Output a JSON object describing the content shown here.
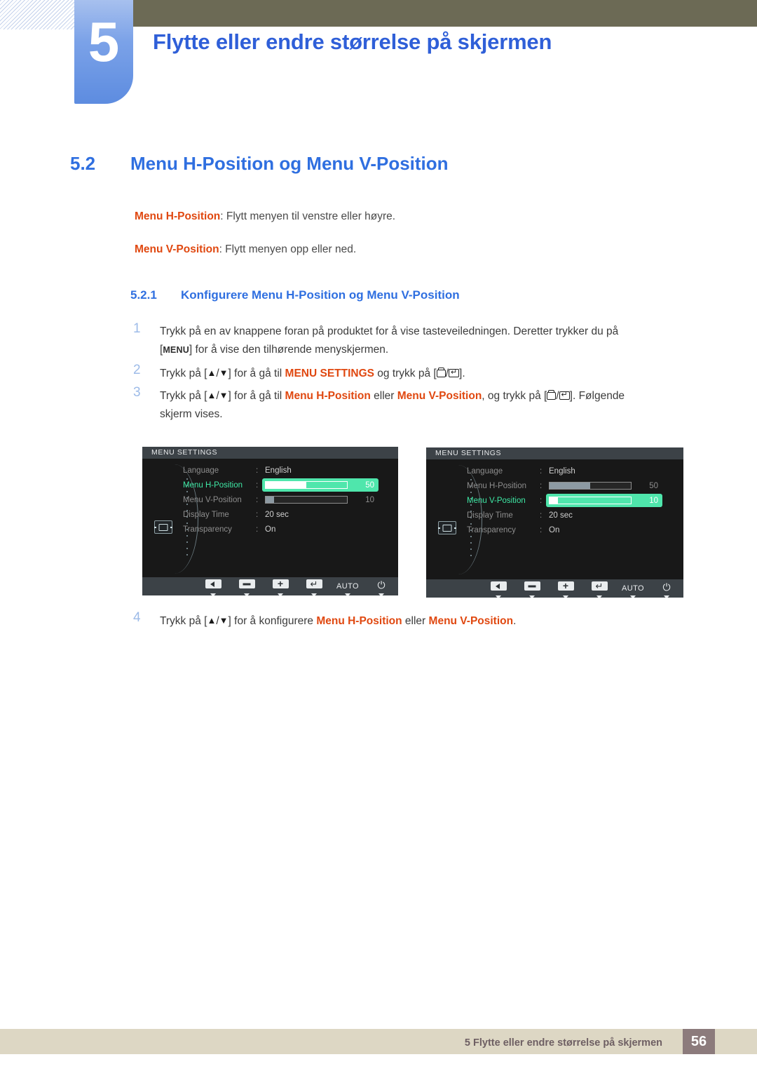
{
  "header": {
    "chapter_number": "5",
    "chapter_title": "Flytte eller endre størrelse på skjermen"
  },
  "section": {
    "number": "5.2",
    "title": "Menu H-Position og Menu V-Position"
  },
  "intro": {
    "line1_keyword": "Menu H-Position",
    "line1_rest": ": Flytt menyen til venstre eller høyre.",
    "line2_keyword": "Menu V-Position",
    "line2_rest": ": Flytt menyen opp eller ned."
  },
  "subsection": {
    "number": "5.2.1",
    "title": "Konfigurere Menu H-Position og Menu V-Position"
  },
  "steps": {
    "s1": {
      "num": "1",
      "a": "Trykk på en av knappene foran på produktet for å vise tasteveiledningen. Deretter trykker du på",
      "menu_key": "MENU",
      "b": "for å vise den tilhørende menyskjermen.",
      "bracket_open": "[",
      "bracket_close": "]"
    },
    "s2": {
      "num": "2",
      "a": "Trykk på [",
      "up": "▲",
      "slash": "/",
      "down": "▼",
      "b": "] for å gå til",
      "kw": "MENU SETTINGS",
      "c": "og trykk på [",
      "d": "/",
      "e": "]."
    },
    "s3": {
      "num": "3",
      "a": "Trykk på [",
      "up": "▲",
      "slash": "/",
      "down": "▼",
      "b": "] for å gå til",
      "kw1": "Menu H-Position",
      "mid": "eller",
      "kw2": "Menu V-Position",
      "c": ", og trykk på [",
      "d": "/",
      "e": "]. Følgende",
      "f": "skjerm vises."
    },
    "s4": {
      "num": "4",
      "a": "Trykk på [",
      "up": "▲",
      "slash": "/",
      "down": "▼",
      "b": "] for å konfigurere",
      "kw1": "Menu H-Position",
      "mid": "eller",
      "kw2": "Menu V-Position",
      "c": "."
    }
  },
  "osd_left": {
    "title": "MENU SETTINGS",
    "highlight_color": "#4fe6ac",
    "highlight_text_color": "#3ee8a5",
    "rows": [
      {
        "label": "Language",
        "value": "English",
        "type": "text"
      },
      {
        "label": "Menu H-Position",
        "type": "slider",
        "value": "50",
        "fill_pct": 50,
        "highlighted": true
      },
      {
        "label": "Menu V-Position",
        "type": "slider",
        "value": "10",
        "fill_pct": 10,
        "highlighted": false
      },
      {
        "label": "Display Time",
        "value": "20 sec",
        "type": "text"
      },
      {
        "label": "Transparency",
        "value": "On",
        "type": "text"
      }
    ],
    "buttons": [
      {
        "name": "left-arrow-button",
        "glyph": "left"
      },
      {
        "name": "minus-button",
        "glyph": "minus"
      },
      {
        "name": "plus-button",
        "glyph": "plus"
      },
      {
        "name": "enter-button",
        "glyph": "enter"
      },
      {
        "name": "auto-button",
        "glyph": "text",
        "label": "AUTO"
      },
      {
        "name": "power-button",
        "glyph": "power",
        "label": "⏻"
      }
    ]
  },
  "osd_right": {
    "title": "MENU SETTINGS",
    "rows": [
      {
        "label": "Language",
        "value": "English",
        "type": "text"
      },
      {
        "label": "Menu H-Position",
        "type": "slider",
        "value": "50",
        "fill_pct": 50,
        "highlighted": false
      },
      {
        "label": "Menu V-Position",
        "type": "slider",
        "value": "10",
        "fill_pct": 10,
        "highlighted": true
      },
      {
        "label": "Display Time",
        "value": "20 sec",
        "type": "text"
      },
      {
        "label": "Transparency",
        "value": "On",
        "type": "text"
      }
    ]
  },
  "footer": {
    "text": "5 Flytte eller endre størrelse på skjermen",
    "page": "56"
  }
}
